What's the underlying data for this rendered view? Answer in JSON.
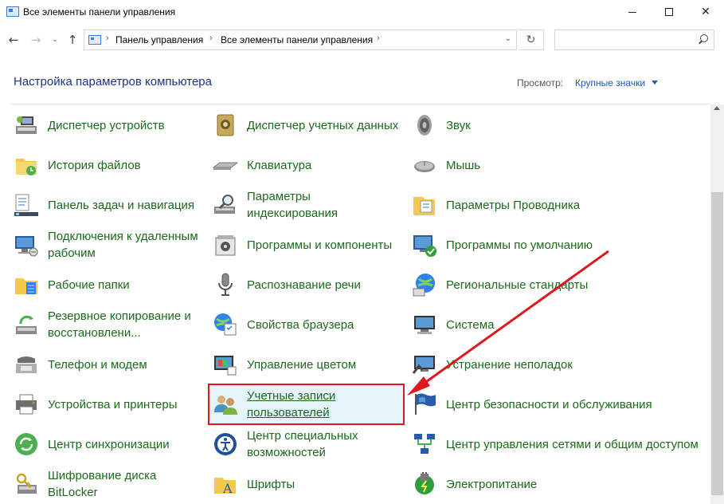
{
  "window": {
    "title": "Все элементы панели управления",
    "minimize": "—",
    "maximize": "☐",
    "close": "✕"
  },
  "nav": {
    "back": "←",
    "forward": "→",
    "history": "⌄",
    "up": "↑",
    "breadcrumb": [
      "Панель управления",
      "Все элементы панели управления"
    ],
    "refresh": "↻",
    "search_placeholder": ""
  },
  "header": {
    "title": "Настройка параметров компьютера",
    "view_label": "Просмотр:",
    "view_value": "Крупные значки"
  },
  "items": {
    "col1": [
      {
        "label": "Диспетчер устройств",
        "icon": "device-manager-icon"
      },
      {
        "label": "История файлов",
        "icon": "file-history-icon"
      },
      {
        "label": "Панель задач и навигация",
        "icon": "taskbar-icon"
      },
      {
        "label": "Подключения к удаленным рабочим",
        "icon": "remote-desktop-icon"
      },
      {
        "label": "Рабочие папки",
        "icon": "work-folders-icon"
      },
      {
        "label": "Резервное копирование и восстановлени...",
        "icon": "backup-icon"
      },
      {
        "label": "Телефон и модем",
        "icon": "phone-modem-icon"
      },
      {
        "label": "Устройства и принтеры",
        "icon": "printer-icon"
      },
      {
        "label": "Центр синхронизации",
        "icon": "sync-center-icon"
      },
      {
        "label": "Шифрование диска BitLocker",
        "icon": "bitlocker-icon"
      }
    ],
    "col2": [
      {
        "label": "Диспетчер учетных данных",
        "icon": "credential-manager-icon"
      },
      {
        "label": "Клавиатура",
        "icon": "keyboard-icon"
      },
      {
        "label": "Параметры индексирования",
        "icon": "indexing-icon"
      },
      {
        "label": "Программы и компоненты",
        "icon": "programs-icon"
      },
      {
        "label": "Распознавание речи",
        "icon": "microphone-icon"
      },
      {
        "label": "Свойства браузера",
        "icon": "internet-options-icon"
      },
      {
        "label": "Управление цветом",
        "icon": "color-management-icon"
      },
      {
        "label": "Учетные записи пользователей",
        "icon": "user-accounts-icon"
      },
      {
        "label": "Центр специальных возможностей",
        "icon": "accessibility-icon"
      },
      {
        "label": "Шрифты",
        "icon": "fonts-icon"
      }
    ],
    "col3": [
      {
        "label": "Звук",
        "icon": "speaker-icon"
      },
      {
        "label": "Мышь",
        "icon": "mouse-icon"
      },
      {
        "label": "Параметры Проводника",
        "icon": "explorer-options-icon"
      },
      {
        "label": "Программы по умолчанию",
        "icon": "default-programs-icon"
      },
      {
        "label": "Региональные стандарты",
        "icon": "region-icon"
      },
      {
        "label": "Система",
        "icon": "system-icon"
      },
      {
        "label": "Устранение неполадок",
        "icon": "troubleshooting-icon"
      },
      {
        "label": "Центр безопасности и обслуживания",
        "icon": "security-flag-icon"
      },
      {
        "label": "Центр управления сетями и общим доступом",
        "icon": "network-icon"
      },
      {
        "label": "Электропитание",
        "icon": "power-icon"
      }
    ]
  },
  "colors": {
    "link": "#1b6a1b",
    "title": "#1e3287",
    "highlight_border": "#e0161e",
    "arrow": "#e0161e"
  }
}
